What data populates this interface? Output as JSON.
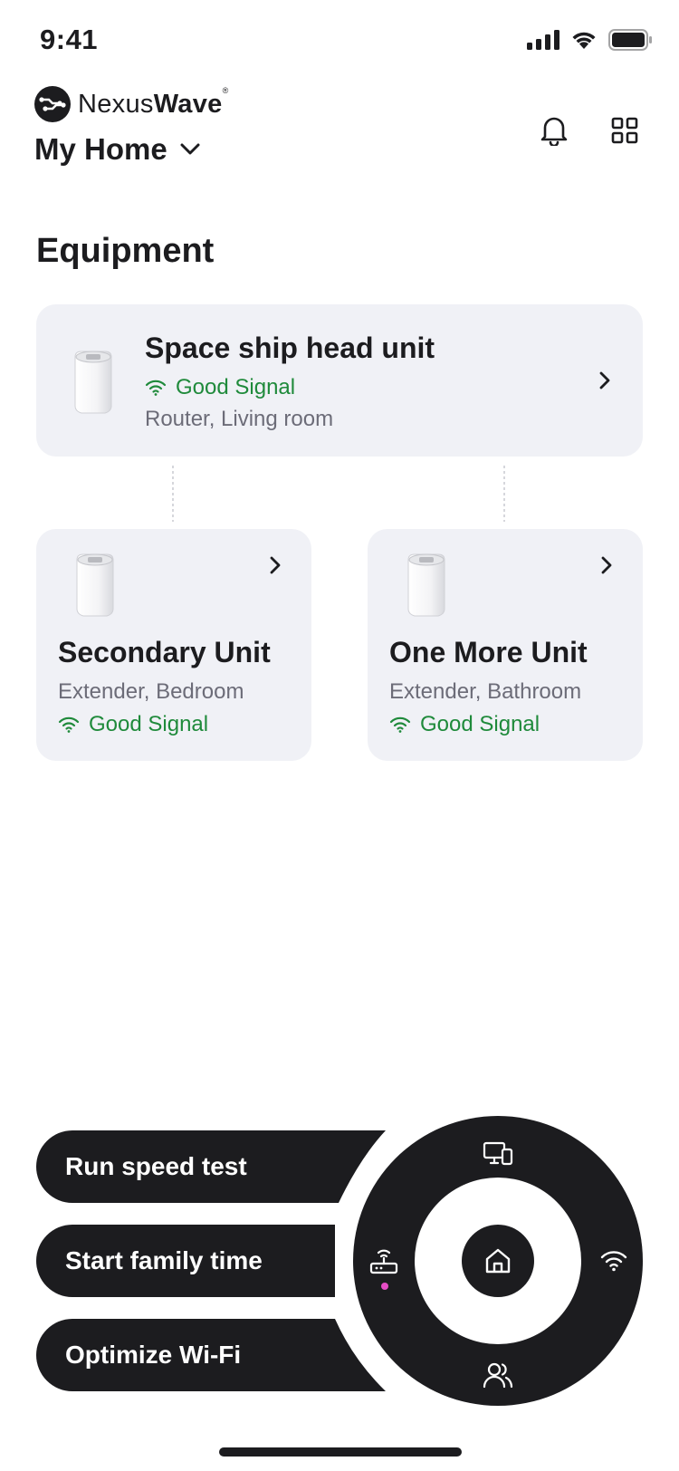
{
  "status_bar": {
    "time": "9:41"
  },
  "brand": {
    "name_light": "Nexus",
    "name_bold": "Wave",
    "registered": "®"
  },
  "header": {
    "home_name": "My Home"
  },
  "section": {
    "title": "Equipment"
  },
  "devices": [
    {
      "name": "Space ship head unit",
      "signal": "Good Signal",
      "role": "Router, Living room"
    },
    {
      "name": "Secondary Unit",
      "signal": "Good Signal",
      "role": "Extender, Bedroom"
    },
    {
      "name": "One More Unit",
      "signal": "Good Signal",
      "role": "Extender, Bathroom"
    }
  ],
  "actions": [
    {
      "label": "Run speed test"
    },
    {
      "label": "Start family time"
    },
    {
      "label": "Optimize Wi-Fi"
    }
  ],
  "radial_menu": {
    "items": [
      "devices-icon",
      "wifi-icon",
      "people-icon",
      "router-icon",
      "home-icon"
    ],
    "active_indicator_color": "#e64dc5"
  },
  "colors": {
    "accent_dark": "#1c1c1f",
    "signal_good": "#1f8a3b",
    "card_bg": "#f0f1f6",
    "muted_text": "#6c6c78"
  }
}
